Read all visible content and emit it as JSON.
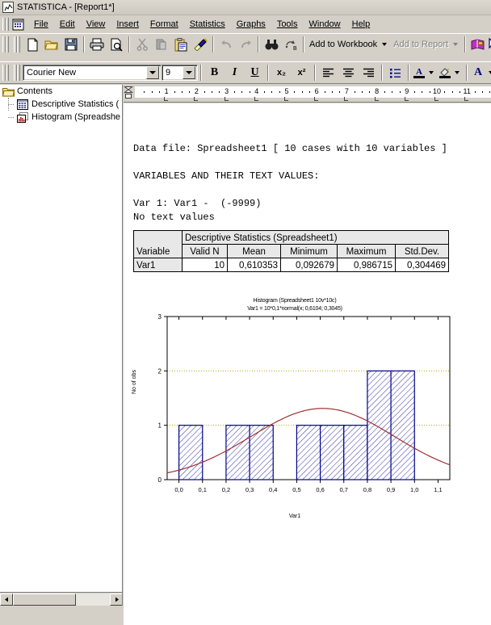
{
  "window": {
    "title": "STATISTICA - [Report1*]",
    "app_icon": "statistica-icon"
  },
  "menu": {
    "items": [
      {
        "label": "File",
        "accel": "F"
      },
      {
        "label": "Edit",
        "accel": "E"
      },
      {
        "label": "View",
        "accel": "V"
      },
      {
        "label": "Insert",
        "accel": "I"
      },
      {
        "label": "Format",
        "accel": "o"
      },
      {
        "label": "Statistics",
        "accel": "S"
      },
      {
        "label": "Graphs",
        "accel": "G"
      },
      {
        "label": "Tools",
        "accel": "T"
      },
      {
        "label": "Window",
        "accel": "W"
      },
      {
        "label": "Help",
        "accel": "H"
      }
    ]
  },
  "toolbar_main": {
    "buttons": [
      {
        "name": "new-document-icon",
        "tip": "New"
      },
      {
        "name": "open-folder-icon",
        "tip": "Open"
      },
      {
        "name": "save-floppy-icon",
        "tip": "Save"
      },
      {
        "name": "print-icon",
        "tip": "Print"
      },
      {
        "name": "print-preview-icon",
        "tip": "Print Preview"
      },
      {
        "name": "cut-scissors-icon",
        "tip": "Cut"
      },
      {
        "name": "copy-icon",
        "tip": "Copy"
      },
      {
        "name": "paste-clipboard-icon",
        "tip": "Paste"
      },
      {
        "name": "format-painter-icon",
        "tip": "Format Painter"
      },
      {
        "name": "undo-arrow-icon",
        "tip": "Undo"
      },
      {
        "name": "redo-arrow-icon",
        "tip": "Redo"
      },
      {
        "name": "find-binoculars-icon",
        "tip": "Find"
      },
      {
        "name": "replace-icon",
        "tip": "Replace"
      }
    ],
    "add_to_workbook": "Add to Workbook",
    "add_to_report": "Add to Report",
    "add_to_report_disabled": true,
    "book_icon": "book-icon",
    "help_icon": "help-pointer-icon"
  },
  "toolbar_format": {
    "font_name": "Courier New",
    "font_size": "9",
    "bold": "B",
    "italic": "I",
    "underline": "U",
    "subscript": "x₂",
    "superscript": "x²",
    "align_left": "align-left-icon",
    "align_center": "align-center-icon",
    "align_right": "align-right-icon",
    "bullets": "bullet-list-icon",
    "font_color": "A",
    "highlight_color": "highlight-icon",
    "font_dialog": "A"
  },
  "tree": {
    "root": "Contents",
    "items": [
      {
        "label": "Descriptive Statistics (",
        "icon": "spreadsheet-icon"
      },
      {
        "label": "Histogram (Spreadshe",
        "icon": "histogram-icon"
      }
    ]
  },
  "ruler": {
    "numbers": [
      "1",
      "2",
      "3",
      "4",
      "5",
      "6",
      "7",
      "8",
      "9",
      "10",
      "11"
    ]
  },
  "document": {
    "text": "Data file: Spreadsheet1 [ 10 cases with 10 variables ]\n\nVARIABLES AND THEIR TEXT VALUES:\n\nVar 1: Var1 -  (-9999)\nNo text values"
  },
  "stats_table": {
    "corner_label": "Variable",
    "title": "Descriptive Statistics (Spreadsheet1)",
    "columns": [
      "Valid N",
      "Mean",
      "Minimum",
      "Maximum",
      "Std.Dev."
    ],
    "rows": [
      {
        "label": "Var1",
        "values": [
          "10",
          "0,610353",
          "0,092679",
          "0,986715",
          "0,304469"
        ]
      }
    ]
  },
  "chart_data": {
    "type": "bar",
    "title": "Histogram (Spreadsheet1 10v*10c)",
    "subtitle": "Var1 = 10*0,1*normal(x; 0,6104; 0,3045)",
    "xlabel": "Var1",
    "ylabel": "No of obs",
    "xlim": [
      -0.05,
      1.15
    ],
    "ylim": [
      0,
      3
    ],
    "xticks": [
      "0,0",
      "0,1",
      "0,2",
      "0,3",
      "0,4",
      "0,5",
      "0,6",
      "0,7",
      "0,8",
      "0,9",
      "1,0",
      "1,1"
    ],
    "xtick_values": [
      0.0,
      0.1,
      0.2,
      0.3,
      0.4,
      0.5,
      0.6,
      0.7,
      0.8,
      0.9,
      1.0,
      1.1
    ],
    "yticks": [
      "0",
      "1",
      "2",
      "3"
    ],
    "ytick_values": [
      0,
      1,
      2,
      3
    ],
    "grid": true,
    "bin_width": 0.1,
    "bins": [
      {
        "x0": 0.0,
        "x1": 0.1,
        "count": 1
      },
      {
        "x0": 0.1,
        "x1": 0.2,
        "count": 0
      },
      {
        "x0": 0.2,
        "x1": 0.3,
        "count": 1
      },
      {
        "x0": 0.3,
        "x1": 0.4,
        "count": 1
      },
      {
        "x0": 0.4,
        "x1": 0.5,
        "count": 0
      },
      {
        "x0": 0.5,
        "x1": 0.6,
        "count": 1
      },
      {
        "x0": 0.6,
        "x1": 0.7,
        "count": 1
      },
      {
        "x0": 0.7,
        "x1": 0.8,
        "count": 1
      },
      {
        "x0": 0.8,
        "x1": 0.9,
        "count": 2
      },
      {
        "x0": 0.9,
        "x1": 1.0,
        "count": 2
      },
      {
        "x0": 1.0,
        "x1": 1.1,
        "count": 0
      }
    ],
    "fit_curve": {
      "name": "normal",
      "n": 10,
      "binwidth": 0.1,
      "mean": 0.6104,
      "sd": 0.3045,
      "color": "#a03030"
    },
    "bar_fill": "#ffffff",
    "bar_hatch": "#3333aa",
    "bar_edge": "#00008b"
  },
  "colors": {
    "window_bg": "#d4d0c8",
    "doc_bg": "#ffffff",
    "accent": "#000080",
    "curve": "#a03030",
    "bar_edge": "#00008b"
  }
}
